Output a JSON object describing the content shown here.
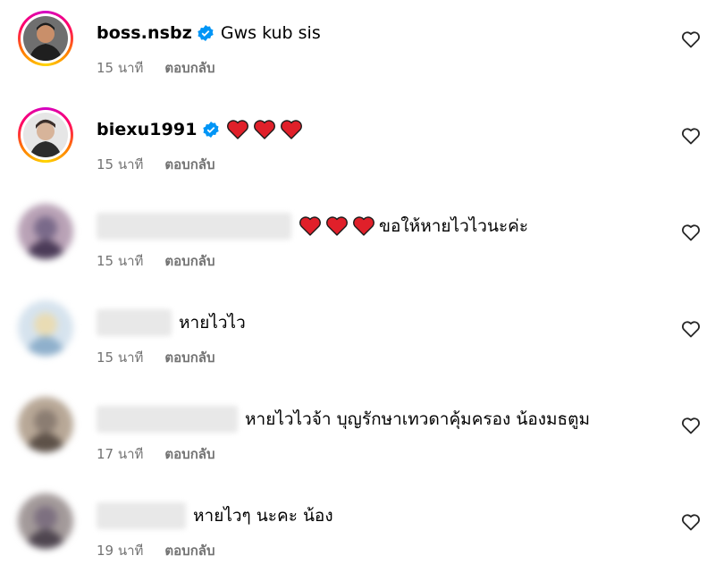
{
  "comments": [
    {
      "username": "boss.nsbz",
      "verified": true,
      "text": "Gws kub sis",
      "hearts": 0,
      "time": "15 นาที",
      "reply_label": "ตอบกลับ",
      "avatar_colors": [
        "#2b2b2b",
        "#c98f6a",
        "#1c1c1c"
      ]
    },
    {
      "username": "biexu1991",
      "verified": true,
      "text": "",
      "hearts": 3,
      "time": "15 นาที",
      "reply_label": "ตอบกลับ",
      "avatar_colors": [
        "#d9d9d9",
        "#d7b49a",
        "#3a2e2a"
      ]
    },
    {
      "username": "",
      "verified": false,
      "text": "ขอให้หายไวไวนะค่ะ",
      "hearts": 3,
      "time": "15 นาที",
      "reply_label": "ตอบกลับ",
      "avatar_colors": [
        "#7a6a8a",
        "#b9a2b6",
        "#4b3b58"
      ]
    },
    {
      "username": "",
      "verified": false,
      "text": "หายไวไว",
      "hearts": 0,
      "time": "15 นาที",
      "reply_label": "ตอบกลับ",
      "avatar_colors": [
        "#a9c3d8",
        "#e9dcb4",
        "#8fb0cc"
      ]
    },
    {
      "username": "",
      "verified": false,
      "text": "หายไวไวจ้า บุญรักษาเทวดาคุ้มครอง น้องมธตูม",
      "hearts": 0,
      "time": "17 นาที",
      "reply_label": "ตอบกลับ",
      "avatar_colors": [
        "#8b7d72",
        "#b8a897",
        "#5d5148"
      ]
    },
    {
      "username": "",
      "verified": false,
      "text": "หายไวๆ นะคะ น้อง",
      "hearts": 0,
      "time": "19 นาที",
      "reply_label": "ตอบกลับ",
      "avatar_colors": [
        "#7d7080",
        "#a39a9a",
        "#4f4650"
      ]
    }
  ],
  "colors": {
    "verified_badge": "#0095f6",
    "heart_emoji": "#e0202a",
    "secondary_text": "#737373"
  },
  "icons": {
    "verified": "verified-badge-icon",
    "like": "heart-outline-icon",
    "emoji": "red-heart-emoji"
  }
}
